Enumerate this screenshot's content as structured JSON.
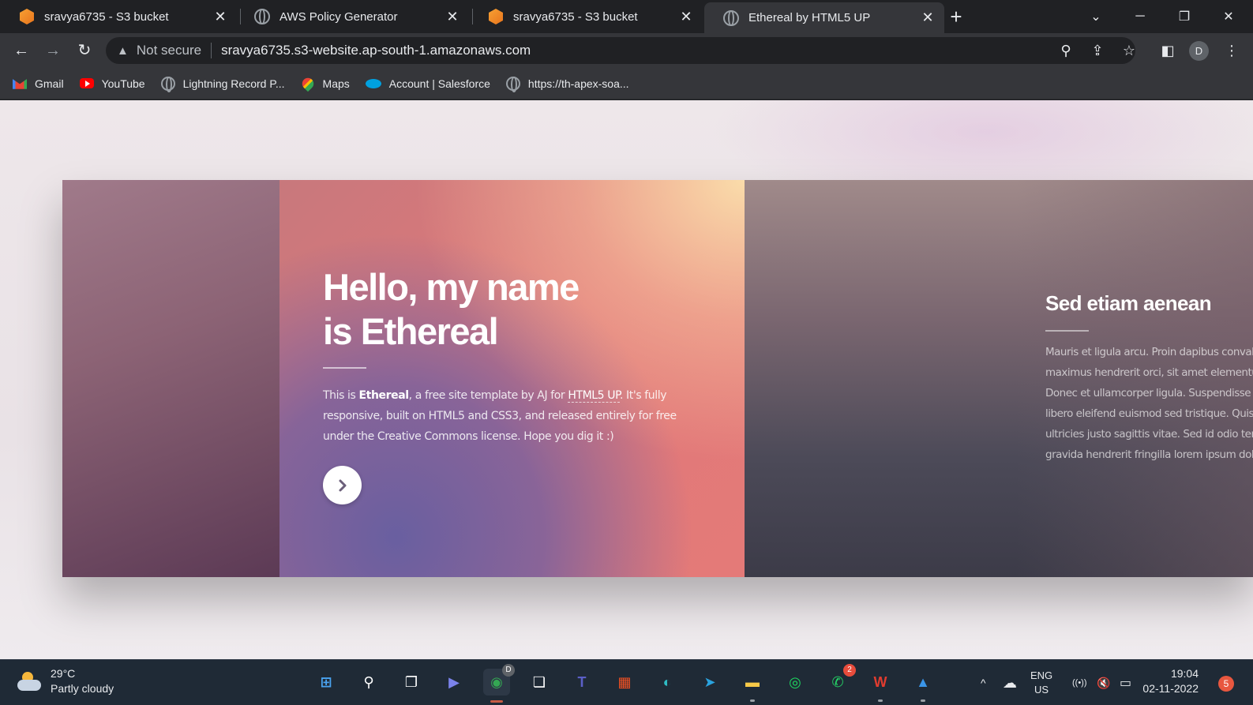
{
  "tabs": [
    {
      "title": "sravya6735 - S3 bucket",
      "icon": "aws-cube-icon",
      "active": false
    },
    {
      "title": "AWS Policy Generator",
      "icon": "globe-icon",
      "active": false
    },
    {
      "title": "sravya6735 - S3 bucket",
      "icon": "aws-cube-icon",
      "active": false
    },
    {
      "title": "Ethereal by HTML5 UP",
      "icon": "globe-icon",
      "active": true
    }
  ],
  "tab_close_glyph": "✕",
  "new_tab_glyph": "+",
  "window_controls": {
    "tab_search": "⌄",
    "minimize": "─",
    "restore": "❐",
    "close": "✕"
  },
  "toolbar": {
    "back": "←",
    "forward": "→",
    "reload": "↻",
    "security_warning": "▲",
    "security_label": "Not secure",
    "url": "sravya6735.s3-website.ap-south-1.amazonaws.com",
    "zoom": "⚲",
    "share": "⇪",
    "bookmark": "☆",
    "sidepanel": "◧",
    "profile_initial": "D",
    "menu": "⋮"
  },
  "bookmarks": [
    {
      "label": "Gmail",
      "icon": "gmail-icon"
    },
    {
      "label": "YouTube",
      "icon": "youtube-icon"
    },
    {
      "label": "Lightning Record P...",
      "icon": "globe-icon"
    },
    {
      "label": "Maps",
      "icon": "maps-icon"
    },
    {
      "label": "Account | Salesforce",
      "icon": "salesforce-icon"
    },
    {
      "label": "https://th-apex-soa...",
      "icon": "globe-icon"
    }
  ],
  "intro": {
    "title_line1": "Hello, my name",
    "title_line2": "is Ethereal",
    "text_before": "This is ",
    "text_bold": "Ethereal",
    "text_middle": ", a free site template by AJ for ",
    "text_link": "HTML5 UP",
    "text_after": ". It's fully responsive, built on HTML5 and CSS3, and released entirely for free under the Creative Commons license. Hope you dig it :)"
  },
  "section": {
    "title": "Sed etiam aenean",
    "lines": [
      "Mauris et ligula arcu. Proin dapibus convallis accumsan",
      "maximus hendrerit orci, sit amet elementum massa ho",
      "Donec et ullamcorper ligula. Suspendisse amet poten",
      "libero eleifend euismod sed tristique. Quisque dictum",
      "ultricies justo sagittis vitae. Sed id odio tempor, portti",
      "gravida hendrerit fringilla lorem ipsum dolor."
    ]
  },
  "taskbar": {
    "temperature": "29°C",
    "condition": "Partly cloudy",
    "apps": [
      {
        "name": "windows-start-icon",
        "glyph": "⊞",
        "color": "#4aa3f0"
      },
      {
        "name": "search-icon",
        "glyph": "⚲",
        "color": "#ffffff"
      },
      {
        "name": "task-view-icon",
        "glyph": "❐",
        "color": "#ffffff"
      },
      {
        "name": "teams-chat-icon",
        "glyph": "▶",
        "color": "#7b83eb"
      },
      {
        "name": "chrome-icon",
        "glyph": "◉",
        "color": "#34a853"
      },
      {
        "name": "chat-icon",
        "glyph": "❏",
        "color": "#ffffff"
      },
      {
        "name": "teams-icon",
        "glyph": "T",
        "color": "#5b5fc7"
      },
      {
        "name": "microsoft-store-icon",
        "glyph": "▦",
        "color": "#f25022"
      },
      {
        "name": "edge-icon",
        "glyph": "◐",
        "color": "#2fbcc4"
      },
      {
        "name": "telegram-icon",
        "glyph": "➤",
        "color": "#2aa3df"
      },
      {
        "name": "file-explorer-icon",
        "glyph": "▬",
        "color": "#f7c948"
      },
      {
        "name": "spotify-icon",
        "glyph": "◎",
        "color": "#1ed760"
      },
      {
        "name": "whatsapp-icon",
        "glyph": "✆",
        "color": "#25d366"
      },
      {
        "name": "wps-office-icon",
        "glyph": "W",
        "color": "#e13c2f"
      },
      {
        "name": "photos-icon",
        "glyph": "▲",
        "color": "#3a95e8"
      }
    ],
    "chrome_badge": "D",
    "whatsapp_badge": "2",
    "tray_chevron": "^",
    "onedrive": "☁",
    "lang_line1": "ENG",
    "lang_line2": "US",
    "wifi": "((•))",
    "volume": "🔇",
    "battery": "▭",
    "time": "19:04",
    "date": "02-11-2022",
    "notification_count": "5"
  }
}
